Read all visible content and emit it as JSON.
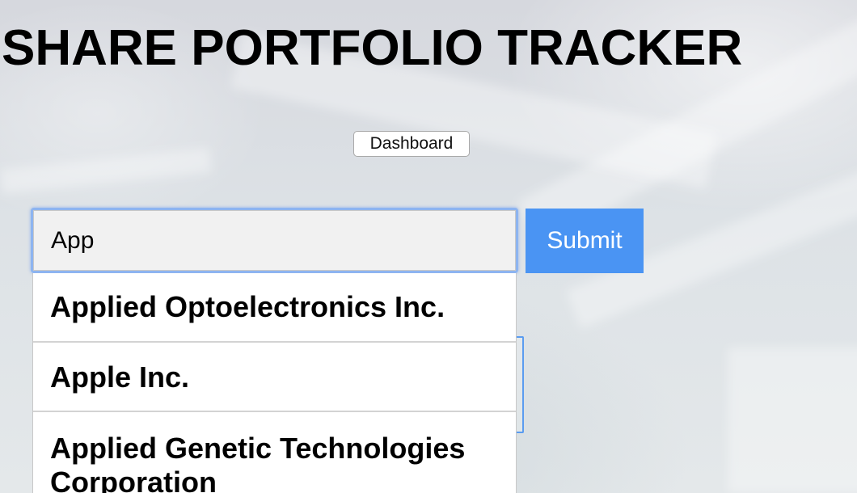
{
  "header": {
    "title": "SHARE PORTFOLIO TRACKER"
  },
  "nav": {
    "dashboard_label": "Dashboard"
  },
  "search": {
    "value": "App",
    "submit_label": "Submit"
  },
  "autocomplete": {
    "options": [
      "Applied Optoelectronics Inc.",
      "Apple Inc.",
      "Applied Genetic Technologies Corporation"
    ]
  },
  "colors": {
    "submit_bg": "#4a94f3",
    "focus_ring": "#8db4f0"
  }
}
